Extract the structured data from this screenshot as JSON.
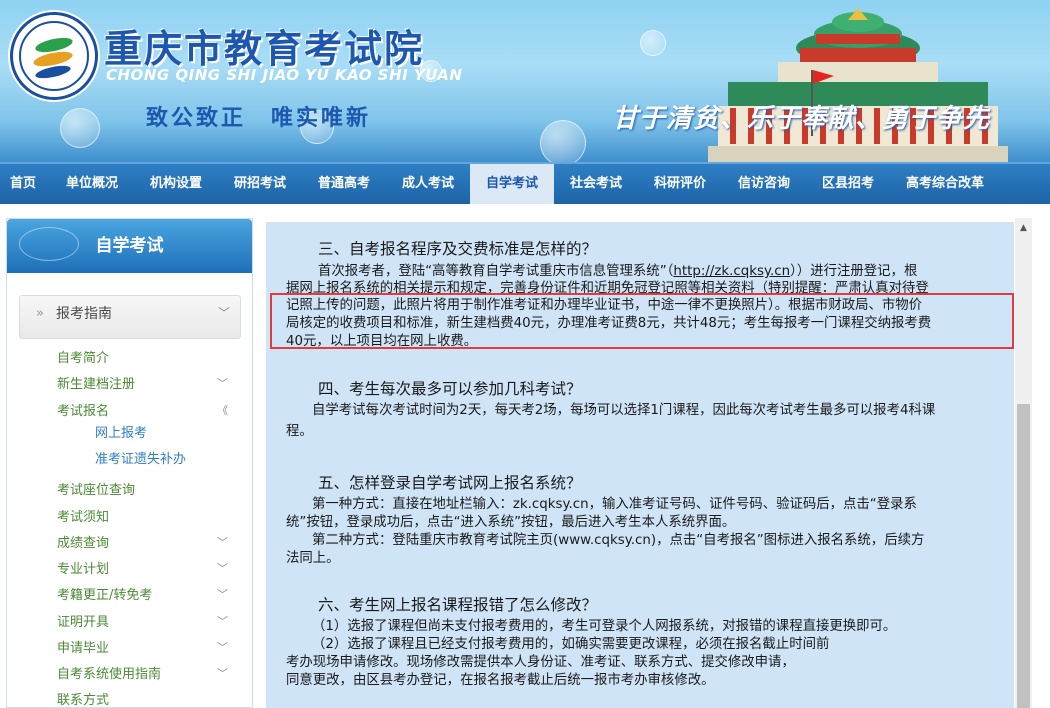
{
  "header": {
    "title": "重庆市教育考试院",
    "subtitle": "CHONG QING SHI JIAO YU KAO SHI YUAN",
    "motto_left": "致公致正　唯实唯新",
    "motto_right": "甘于清贫、乐于奉献、勇于争先",
    "colors": {
      "title": "#1d57b0",
      "nav": "#1d63a8",
      "highlight_box": "#e23b3b"
    }
  },
  "nav": {
    "items": [
      "首页",
      "单位概况",
      "机构设置",
      "研招考试",
      "普通高考",
      "成人考试",
      "自学考试",
      "社会考试",
      "科研评价",
      "信访咨询",
      "区县招考",
      "高考综合改革"
    ],
    "active": "自学考试"
  },
  "sidebar": {
    "header": "自学考试",
    "section": "报考指南",
    "items": [
      {
        "label": "自考简介"
      },
      {
        "label": "新生建档注册"
      },
      {
        "label": "考试报名"
      },
      {
        "label": "网上报考"
      },
      {
        "label": "准考证遗失补办"
      },
      {
        "label": "考试座位查询"
      },
      {
        "label": "考试须知"
      },
      {
        "label": "成绩查询"
      },
      {
        "label": "专业计划"
      },
      {
        "label": "考籍更正/转免考"
      },
      {
        "label": "证明开具"
      },
      {
        "label": "申请毕业"
      },
      {
        "label": "自考系统使用指南"
      },
      {
        "label": "联系方式"
      }
    ]
  },
  "content": {
    "q3_title": "三、自考报名程序及交费标准是怎样的？",
    "q3_l1": "首次报考者，登陆“高等教育自学考试重庆市信息管理系统”（",
    "q3_link": "http://zk.cqksy.cn",
    "q3_l1b": "））进行注册登记，根",
    "q3_l2": "据网上报名系统的相关提示和规定，完善身份证件和近期免冠登记照等相关资料（特别提醒：严肃认真对待登",
    "q3_l3": "记照上传的问题，此照片将用于制作准考证和办理毕业证书，中途一律不更换照片）。根据市财政局、市物价",
    "q3_l4": "局核定的收费项目和标准，新生建档费40元，办理准考证费8元，共计48元；考生每报考一门课程交纳报考费",
    "q3_l5": "40元，以上项目均在网上收费。",
    "q4_title": "四、考生每次最多可以参加几科考试？",
    "q4_l1": "自学考试每次考试时间为2天，每天考2场，每场可以选择1门课程，因此每次考试考生最多可以报考4科课",
    "q4_l2": "程。",
    "q5_title": "五、怎样登录自学考试网上报名系统？",
    "q5_l1": "第一种方式：直接在地址栏输入：zk.cqksy.cn，输入准考证号码、证件号码、验证码后，点击“登录系",
    "q5_l2": "统”按钮，登录成功后，点击“进入系统”按钮，最后进入考生本人系统界面。",
    "q5_l3": "第二种方式：登陆重庆市教育考试院主页(www.cqksy.cn)，点击“自考报名”图标进入报名系统，后续方",
    "q5_l4": "法同上。",
    "q6_title": "六、考生网上报名课程报错了怎么修改？",
    "q6_l1": "（1）选报了课程但尚未支付报考费用的，考生可登录个人网报系统，对报错的课程直接更换即可。",
    "q6_l2": "（2）选报了课程且已经支付报考费用的，如确实需要更改课程，必须在报名截止时间前",
    "q6_l3": "考办现场申请修改。现场修改需提供本人身份证、准考证、联系方式、提交修改申请，",
    "q6_l4": "同意更改，由区县考办登记，在报名报考截止后统一报市考办审核修改。"
  }
}
